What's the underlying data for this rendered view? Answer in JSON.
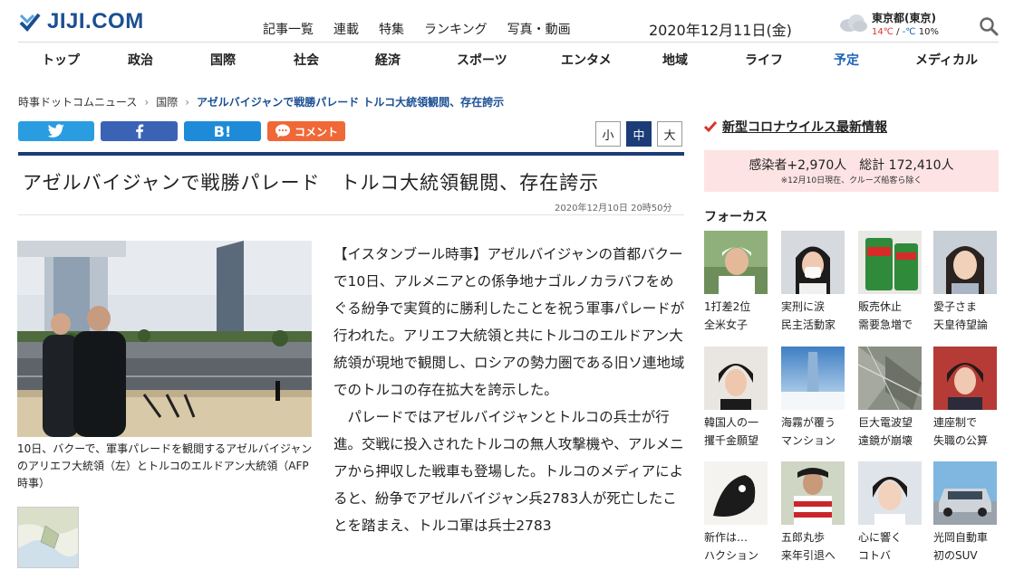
{
  "header": {
    "logo_text": "JIJI.COM",
    "top_nav": [
      "記事一覧",
      "連載",
      "特集",
      "ランキング",
      "写真・動画"
    ],
    "date": "2020年12月11日(金)",
    "weather": {
      "location": "東京都(東京)",
      "high": "14℃",
      "sep": " / ",
      "low": "-℃",
      "rain": " 10%"
    },
    "main_nav": [
      "トップ",
      "政治",
      "国際",
      "社会",
      "経済",
      "スポーツ",
      "エンタメ",
      "地域",
      "ライフ",
      "予定",
      "メディカル"
    ],
    "main_nav_active": "予定"
  },
  "breadcrumb": {
    "items": [
      "時事ドットコムニュース",
      "国際"
    ],
    "separator": "›",
    "current": "アゼルバイジャンで戦勝パレード トルコ大統領観閲、存在誇示"
  },
  "share": {
    "hatena": "B!",
    "comment": "コメント"
  },
  "font_size": [
    "小",
    "中",
    "大"
  ],
  "article": {
    "title": "アゼルバイジャンで戦勝パレード　トルコ大統領観閲、存在誇示",
    "timestamp": "2020年12月10日 20時50分",
    "caption": "10日、バクーで、軍事パレードを観閲するアゼルバイジャンのアリエフ大統領（左）とトルコのエルドアン大統領（AFP時事）",
    "paragraph1": "【イスタンブール時事】アゼルバイジャンの首都バクーで10日、アルメニアとの係争地ナゴルノカラバフをめぐる紛争で実質的に勝利したことを祝う軍事パレードが行われた。アリエフ大統領と共にトルコのエルドアン大統領が現地で観閲し、ロシアの勢力圏である旧ソ連地域でのトルコの存在拡大を誇示した。",
    "paragraph2": "　パレードではアゼルバイジャンとトルコの兵士が行進。交戦に投入されたトルコの無人攻撃機や、アルメニアから押収した戦車も登場した。トルコのメディアによると、紛争でアゼルバイジャン兵2783人が死亡したことを踏まえ、トルコ軍は兵士2783"
  },
  "covid": {
    "link": "新型コロナウイルス最新情報",
    "stats": "感染者+2,970人　総計 172,410人",
    "note": "※12月10日現在、クルーズ船客ら除く"
  },
  "focus": {
    "heading": "フォーカス",
    "tiles": [
      {
        "line1": "1打差2位",
        "line2": "全米女子",
        "icon": "golfer-photo"
      },
      {
        "line1": "実刑に涙",
        "line2": "民主活動家",
        "icon": "activist-photo"
      },
      {
        "line1": "販売休止",
        "line2": "需要急増で",
        "icon": "milo-photo"
      },
      {
        "line1": "愛子さま",
        "line2": "天皇待望論",
        "icon": "princess-photo"
      },
      {
        "line1": "韓国人の一",
        "line2": "攫千金願望",
        "icon": "idol-photo"
      },
      {
        "line1": "海霧が覆う",
        "line2": "マンション",
        "icon": "tower-photo"
      },
      {
        "line1": "巨大電波望",
        "line2": "遠鏡が崩壊",
        "icon": "telescope-photo"
      },
      {
        "line1": "連座制で",
        "line2": "失職の公算",
        "icon": "politician-photo"
      },
      {
        "line1": "新作は…",
        "line2": "ハクション",
        "icon": "cartoon-photo"
      },
      {
        "line1": "五郎丸歩",
        "line2": "来年引退へ",
        "icon": "rugby-photo"
      },
      {
        "line1": "心に響く",
        "line2": "コトバ",
        "icon": "girl-photo"
      },
      {
        "line1": "光岡自動車",
        "line2": "初のSUV",
        "icon": "car-photo"
      }
    ]
  },
  "colors": {
    "navy": "#1b3c77",
    "link_blue": "#1b4f93",
    "twitter": "#2a9de0",
    "facebook": "#3a63b6",
    "hatena": "#1e8bd9",
    "comment": "#f06837",
    "covid_bg": "#fde3e3",
    "covid_check": "#d9342b"
  }
}
